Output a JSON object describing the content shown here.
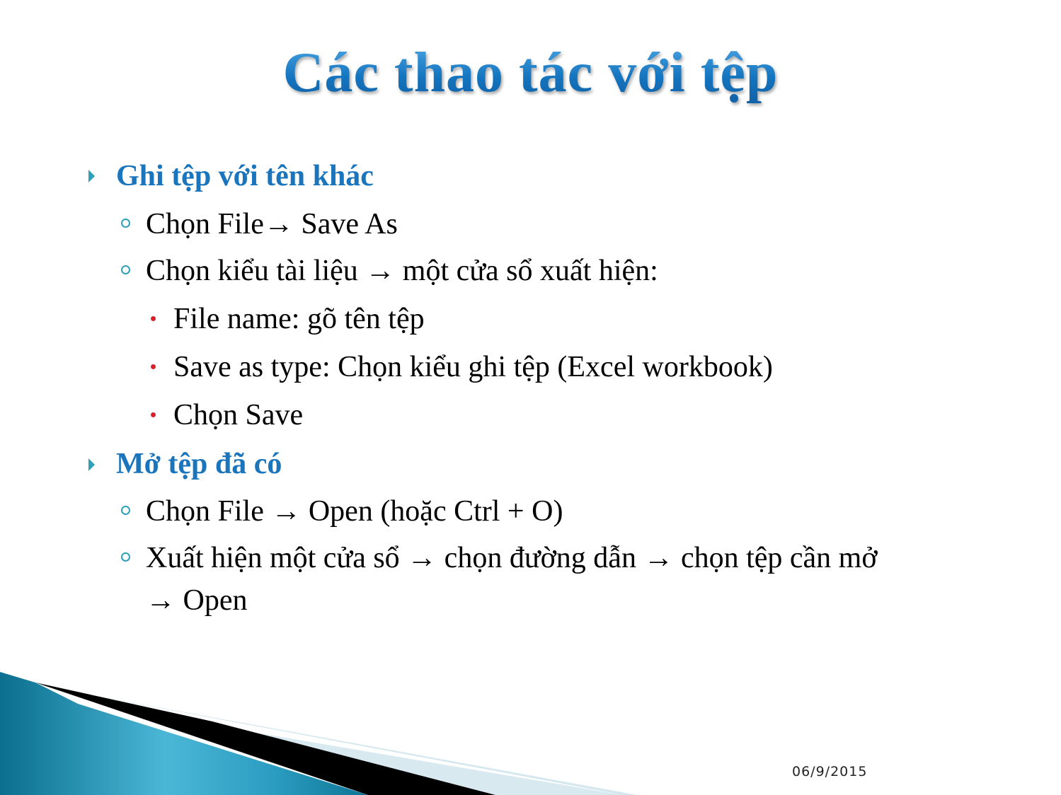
{
  "slide": {
    "title": "Các thao tác với tệp",
    "sections": [
      {
        "heading": "Ghi tệp với tên khác",
        "items": [
          {
            "text": "Chọn File→ Save As"
          },
          {
            "text": "Chọn kiểu tài liệu → một cửa sổ xuất hiện:",
            "subitems": [
              "File name: gõ tên tệp",
              "Save as type: Chọn kiểu ghi tệp (Excel workbook)",
              "Chọn Save"
            ]
          }
        ]
      },
      {
        "heading": "Mở tệp đã có",
        "items": [
          {
            "text": "Chọn File → Open (hoặc Ctrl + O)"
          },
          {
            "text": "Xuất hiện một cửa sổ → chọn đường dẫn → chọn tệp cần mở",
            "continuation": "→ Open"
          }
        ]
      }
    ],
    "date": "06/9/2015",
    "colors": {
      "title": "#1a7fc8",
      "heading": "#1b75bc",
      "level1_bullet": "#2ea0b8",
      "level3_bullet": "#d4232b",
      "decor_teal": "#1a8fb0"
    }
  }
}
